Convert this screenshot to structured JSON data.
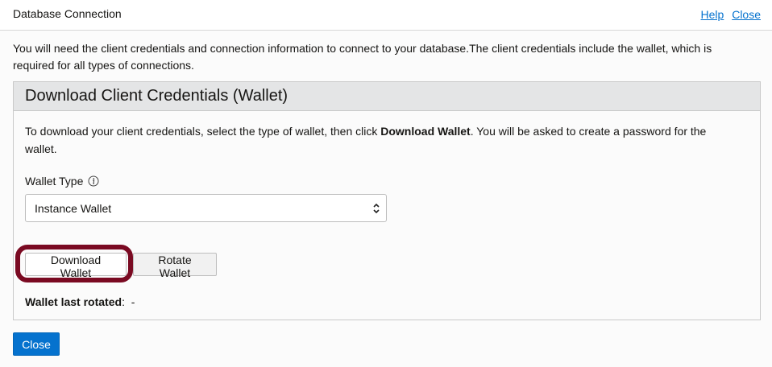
{
  "dialog": {
    "title": "Database Connection",
    "help_link": "Help",
    "close_link": "Close"
  },
  "intro_text": "You will need the client credentials and connection information to connect to your database.The client credentials include the wallet, which is required for all types of connections.",
  "panel": {
    "title": "Download Client Credentials (Wallet)",
    "desc_before": "To download your client credentials, select the type of wallet, then click ",
    "desc_bold": "Download Wallet",
    "desc_after": ". You will be asked to create a password for the wallet.",
    "wallet_type_label": "Wallet Type",
    "info_icon": "info-icon",
    "wallet_type_value": "Instance Wallet",
    "download_button": "Download Wallet",
    "rotate_button": "Rotate Wallet",
    "last_rotated_label": "Wallet last rotated",
    "last_rotated_sep": ":",
    "last_rotated_value": "-"
  },
  "footer": {
    "close_button": "Close"
  },
  "colors": {
    "link": "#0572ce",
    "primary_button": "#0572ce",
    "highlight_ring": "#7a0a22",
    "panel_header_bg": "#e4e5e6"
  }
}
